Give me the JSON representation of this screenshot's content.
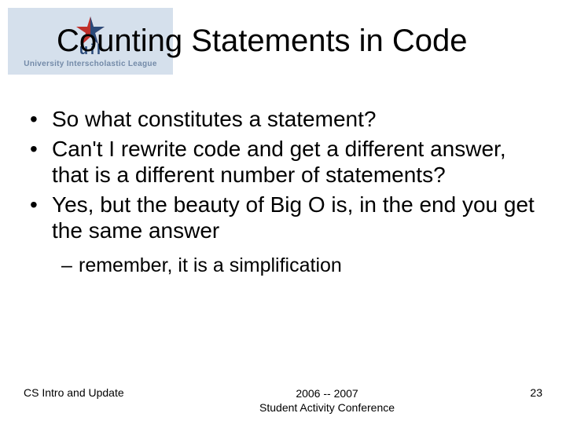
{
  "logo": {
    "org_line": "University Interscholastic League",
    "uil_letters": "uil"
  },
  "title": "Counting Statements in Code",
  "bullets": [
    "So what constitutes a statement?",
    "Can't I rewrite code and get a different answer, that is a different number of statements?",
    "Yes, but the beauty of Big O is, in the end you get the same answer"
  ],
  "sub_bullet": "remember, it is a simplification",
  "footer": {
    "left": "CS Intro and Update",
    "center_line1": "2006 -- 2007",
    "center_line2": "Student Activity Conference",
    "right": "23"
  }
}
